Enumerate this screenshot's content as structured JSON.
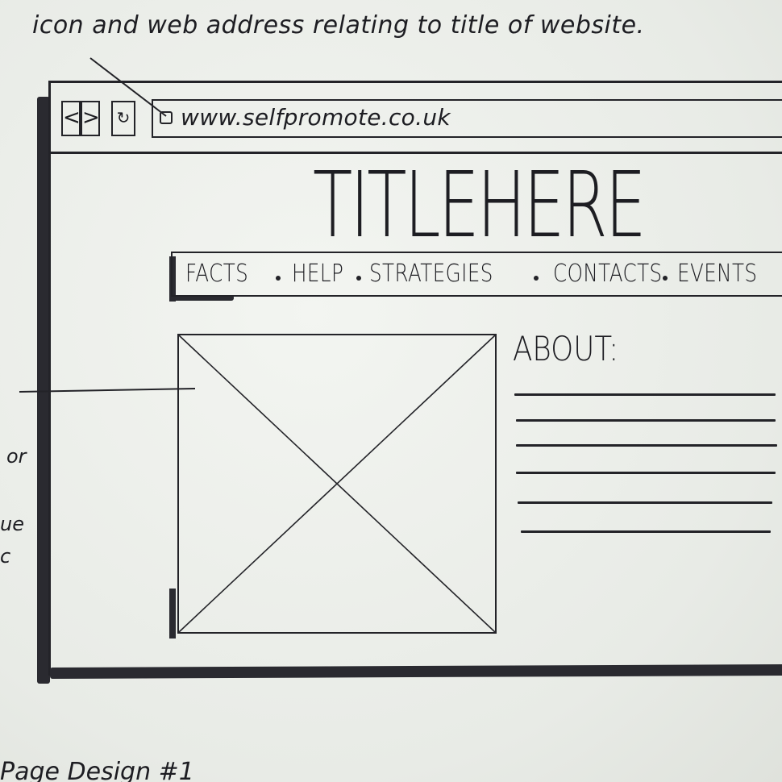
{
  "annotations": {
    "top_note": "icon and web address relating to title of website.",
    "side_note_1": "or",
    "side_note_2": "ue",
    "side_note_3": "c",
    "bottom_note": "Page Design #1"
  },
  "browser": {
    "back_glyph": "<",
    "forward_glyph": ">",
    "refresh_glyph": "↻",
    "url": "www.selfpromote.co.uk",
    "site_icon": "square-site-icon"
  },
  "site": {
    "title": "TITLEHERE",
    "nav": [
      {
        "label": "FACTS"
      },
      {
        "label": "HELP"
      },
      {
        "label": "STRATEGIES"
      },
      {
        "label": "CONTACTS"
      },
      {
        "label": "EVENTS"
      }
    ],
    "about_heading": "ABOUT:",
    "image_placeholder": "image-placeholder-x"
  },
  "colors": {
    "ink": "#232328",
    "paper": "#eef0ec"
  }
}
